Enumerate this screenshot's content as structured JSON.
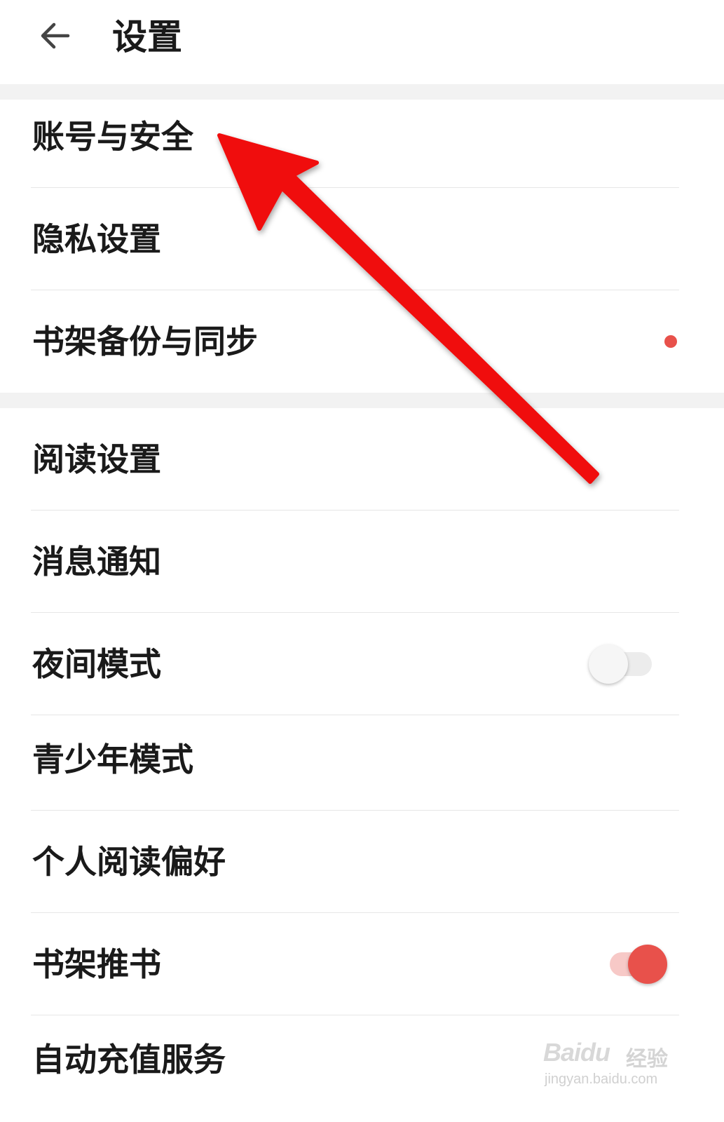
{
  "header": {
    "back_icon": "arrow-left-icon",
    "title": "设置"
  },
  "groups": [
    {
      "items": [
        {
          "label": "账号与安全"
        },
        {
          "label": "隐私设置"
        },
        {
          "label": "书架备份与同步",
          "badge": "red-dot"
        }
      ]
    },
    {
      "items": [
        {
          "label": "阅读设置"
        },
        {
          "label": "消息通知"
        },
        {
          "label": "夜间模式",
          "toggle": false
        },
        {
          "label": "青少年模式"
        },
        {
          "label": "个人阅读偏好"
        },
        {
          "label": "书架推书",
          "toggle": true
        },
        {
          "label": "自动充值服务"
        }
      ]
    }
  ],
  "colors": {
    "accent": "#e8514b",
    "annotation_arrow": "#f01010",
    "divider": "#f2f2f2"
  },
  "watermark": {
    "logo": "Baidu",
    "brand": "经验",
    "url": "jingyan.baidu.com"
  }
}
